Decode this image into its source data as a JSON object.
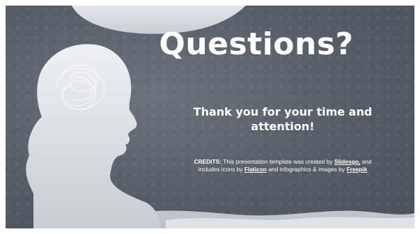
{
  "slide": {
    "title": "Questions?",
    "thanks": "Thank you for your time and attention!",
    "credits": {
      "label": "CREDITS:",
      "text_1": "This presentation template was created by",
      "link_1": "Slidesgo,",
      "text_2": "and includes icons by",
      "link_2": "Flaticon",
      "text_3": "and infographics & images by",
      "link_3": "Freepik"
    }
  },
  "icons": [
    "head-silhouette-icon",
    "scribble-thought-icon"
  ],
  "colors": {
    "background": "#565d66",
    "text": "#ffffff",
    "silhouette": "#e2e6ea",
    "wave": "#d2d6db"
  }
}
